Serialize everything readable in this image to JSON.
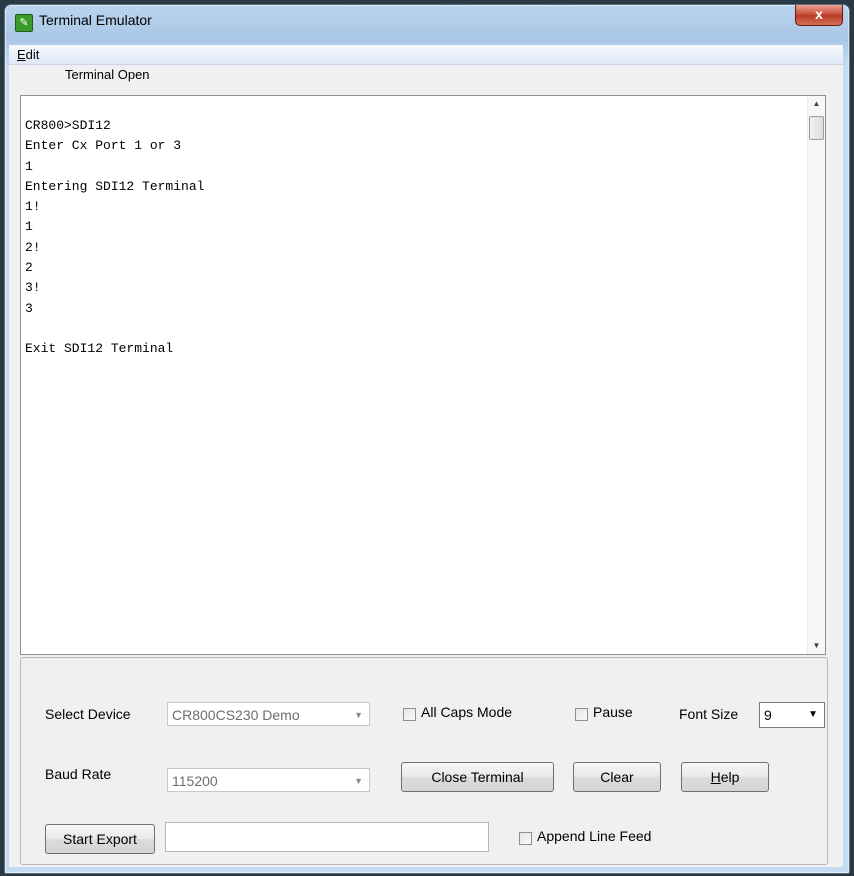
{
  "window": {
    "title": "Terminal Emulator",
    "close_glyph": "x"
  },
  "menu": {
    "edit_underlined": "E",
    "edit_rest": "dit"
  },
  "status": {
    "text": "Terminal Open"
  },
  "terminal": {
    "lines": [
      "CR800>SDI12",
      "Enter Cx Port 1 or 3",
      "1",
      "Entering SDI12 Terminal",
      "1!",
      "1",
      "2!",
      "2",
      "3!",
      "3",
      "",
      "Exit SDI12 Terminal"
    ]
  },
  "controls": {
    "select_device_label": "Select Device",
    "select_device_value": "CR800CS230 Demo",
    "all_caps_label": "All Caps Mode",
    "all_caps_checked": false,
    "pause_label": "Pause",
    "pause_checked": false,
    "font_size_label": "Font Size",
    "font_size_value": "9",
    "baud_rate_label": "Baud Rate",
    "baud_rate_value": "115200",
    "close_terminal_label": "Close Terminal",
    "clear_label": "Clear",
    "help_underlined": "H",
    "help_rest": "elp",
    "start_export_label": "Start Export",
    "export_path_value": "",
    "append_line_feed_label": "Append Line Feed",
    "append_line_feed_checked": false
  },
  "colors": {
    "title_bar": "#a9c7e6",
    "close_button": "#c74a33",
    "client_background": "#f0f0f0",
    "terminal_background": "#ffffff"
  },
  "icons": {
    "app": "pencil-icon",
    "close": "close-icon",
    "dropdown": "chevron-down-icon",
    "scroll_up": "arrow-up-icon",
    "scroll_down": "arrow-down-icon"
  }
}
